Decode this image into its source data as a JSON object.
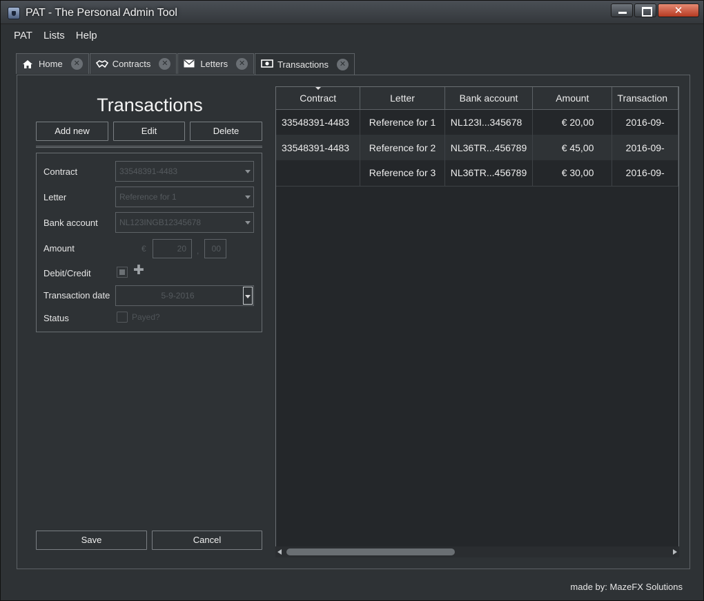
{
  "window": {
    "title": "PAT - The Personal Admin Tool"
  },
  "menu": {
    "items": [
      {
        "label": "PAT"
      },
      {
        "label": "Lists"
      },
      {
        "label": "Help"
      }
    ]
  },
  "tabs": [
    {
      "label": "Home",
      "icon": "home-icon"
    },
    {
      "label": "Contracts",
      "icon": "handshake-icon"
    },
    {
      "label": "Letters",
      "icon": "envelope-icon"
    },
    {
      "label": "Transactions",
      "icon": "money-icon",
      "active": true
    }
  ],
  "panel": {
    "title": "Transactions",
    "buttons": {
      "add": "Add new",
      "edit": "Edit",
      "delete": "Delete",
      "save": "Save",
      "cancel": "Cancel"
    }
  },
  "form": {
    "contract": {
      "label": "Contract",
      "value": "33548391-4483"
    },
    "letter": {
      "label": "Letter",
      "value": "Reference for 1"
    },
    "bank_account": {
      "label": "Bank account",
      "value": "NL123INGB12345678"
    },
    "amount": {
      "label": "Amount",
      "currency": "€",
      "whole": "20",
      "cents": "00",
      "separator": ","
    },
    "debit_credit": {
      "label": "Debit/Credit"
    },
    "transaction_date": {
      "label": "Transaction date",
      "value": "5-9-2016"
    },
    "status": {
      "label": "Status",
      "checkbox_label": "Payed?"
    }
  },
  "table": {
    "columns": [
      "Contract",
      "Letter",
      "Bank account",
      "Amount",
      "Transaction"
    ],
    "rows": [
      {
        "contract": "33548391-4483",
        "letter": "Reference for 1",
        "bank": "NL123I...345678",
        "amount": "€ 20,00",
        "date": "2016-09-"
      },
      {
        "contract": "33548391-4483",
        "letter": "Reference for 2",
        "bank": "NL36TR...456789",
        "amount": "€ 45,00",
        "date": "2016-09-"
      },
      {
        "contract": "",
        "letter": "Reference for 3",
        "bank": "NL36TR...456789",
        "amount": "€ 30,00",
        "date": "2016-09-"
      }
    ]
  },
  "footer": {
    "credit": "made by: MazeFX Solutions"
  }
}
